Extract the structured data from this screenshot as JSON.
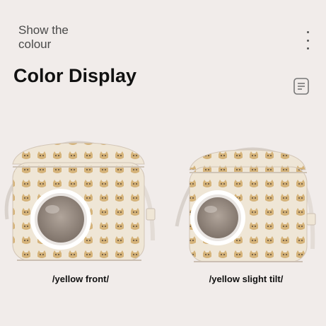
{
  "header": {
    "subtitle": "Show the colour",
    "title": "Color Display"
  },
  "icons": {
    "more": "more-vertical-icon",
    "notes": "notes-icon"
  },
  "products": [
    {
      "caption": "/yellow front/"
    },
    {
      "caption": "/yellow slight tilt/"
    }
  ],
  "colors": {
    "background": "#f1ecea",
    "bag_body": "#efe6d6",
    "pattern": "#c9a46a",
    "window": "#8e8178"
  }
}
